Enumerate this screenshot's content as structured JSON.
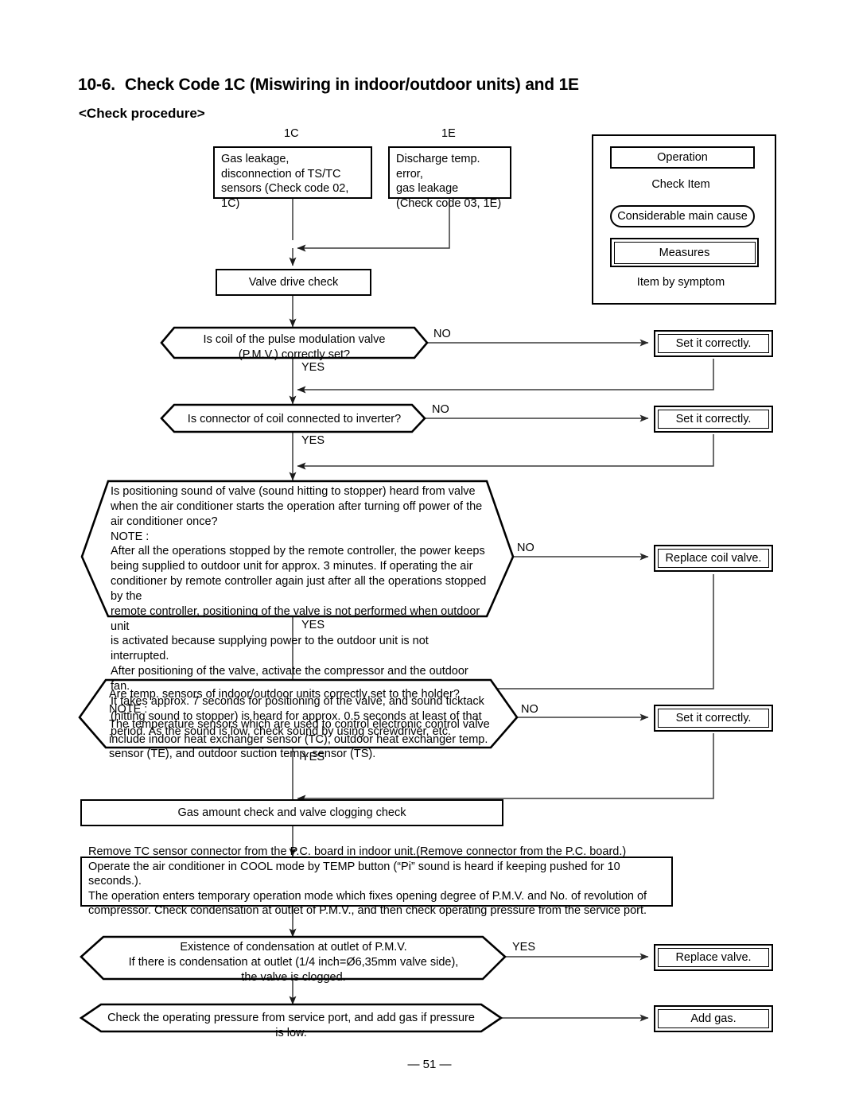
{
  "document": {
    "section_number": "10-6.",
    "title": "Check Code 1C (Miswiring in indoor/outdoor units) and 1E",
    "subtitle": "<Check procedure>",
    "page_number": "— 51 —"
  },
  "legend": {
    "items": [
      {
        "shape": "rectangle",
        "label": "Operation"
      },
      {
        "shape": "hexagon",
        "label": "Check Item"
      },
      {
        "shape": "rounded-rectangle",
        "label": "Considerable main cause"
      },
      {
        "shape": "double-rectangle",
        "label": "Measures"
      },
      {
        "shape": "cut-corner-rectangle",
        "label": "Item by symptom"
      }
    ]
  },
  "flowchart": {
    "code_labels": {
      "left": "1C",
      "right": "1E"
    },
    "start_boxes": [
      {
        "id": "start-1c",
        "lines": [
          "Gas leakage,",
          "disconnection of TS/TC",
          "sensors (Check code 02, 1C)"
        ]
      },
      {
        "id": "start-1e",
        "lines": [
          "Discharge temp. error,",
          "gas leakage",
          "(Check code 03, 1E)"
        ]
      }
    ],
    "operations": {
      "valve_drive_check": "Valve drive check",
      "gas_amount_check": "Gas amount check and valve clogging check",
      "temporary_operation": [
        "Remove TC sensor connector from the P.C. board in indoor unit.(Remove connector from the P.C. board.)",
        "Operate the air conditioner in COOL mode by TEMP button (“Pi” sound is heard if keeping pushed for 10 seconds.).",
        "The operation enters temporary operation mode which fixes opening degree of P.M.V. and No. of revolution of",
        "compressor. Check condensation at outlet of P.M.V., and then check operating pressure from the service port."
      ]
    },
    "decisions": [
      {
        "id": "d1",
        "lines": [
          "Is coil of the pulse modulation valve",
          "(P.M.V.) correctly set?"
        ],
        "no_label": "NO",
        "yes_label": "YES",
        "no_target": "Set it correctly."
      },
      {
        "id": "d2",
        "lines": [
          "Is connector of coil connected to inverter?"
        ],
        "no_label": "NO",
        "yes_label": "YES",
        "no_target": "Set it correctly."
      },
      {
        "id": "d3",
        "lines": [
          "Is positioning sound of valve (sound hitting to stopper) heard from valve",
          "when the air conditioner starts the operation after turning off power of the",
          "air conditioner once?",
          "NOTE :",
          "After all the operations stopped by the remote controller, the power keeps",
          "being supplied to outdoor unit for approx. 3 minutes. If operating the air",
          "conditioner by remote controller again just after all the operations stopped by the",
          "remote controller, positioning of the valve is not performed when outdoor unit",
          "is activated because supplying power to the outdoor unit is not interrupted.",
          "After positioning of the valve, activate the compressor and the outdoor fan.",
          "It takes approx. 7 seconds for positioning of the valve, and sound ticktack",
          "(hitting sound to stopper) is heard for approx. 0.5 seconds at least of that",
          "period. As the sound is low, check sound by using screwdriver, etc."
        ],
        "no_label": "NO",
        "yes_label": "YES",
        "no_target": "Replace coil valve."
      },
      {
        "id": "d4",
        "lines": [
          "Are temp. sensors of indoor/outdoor units correctly set to the holder?",
          "NOTE :",
          "The temperature sensors which are used to control electronic control valve",
          "include indoor heat exchanger sensor (TC), outdoor heat exchanger temp.",
          "sensor (TE), and outdoor suction temp. sensor (TS)."
        ],
        "no_label": "NO",
        "yes_label": "YES",
        "no_target": "Set it correctly."
      },
      {
        "id": "d5",
        "lines": [
          "Existence of condensation at outlet of P.M.V.",
          "If there is condensation at outlet (1/4 inch=Ø6,35mm valve side),",
          "the valve is clogged."
        ],
        "yes_label": "YES",
        "yes_target": "Replace valve."
      },
      {
        "id": "d6",
        "lines": [
          "Check the operating pressure from service port, and add gas if pressure is low."
        ],
        "yes_target": "Add gas."
      }
    ],
    "measures": [
      {
        "id": "m1",
        "label": "Set it correctly."
      },
      {
        "id": "m2",
        "label": "Set it correctly."
      },
      {
        "id": "m3",
        "label": "Replace coil valve."
      },
      {
        "id": "m4",
        "label": "Set it correctly."
      },
      {
        "id": "m5",
        "label": "Replace valve."
      },
      {
        "id": "m6",
        "label": "Add gas."
      }
    ]
  },
  "colors": {
    "ink": "#000000",
    "paper": "#ffffff",
    "wire": "#3a3a3a"
  }
}
